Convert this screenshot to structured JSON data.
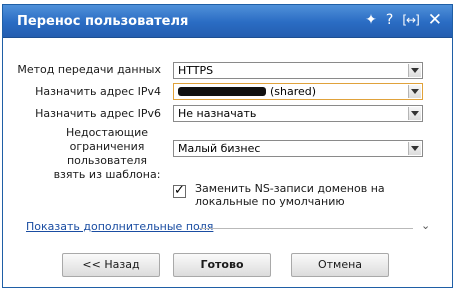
{
  "window": {
    "title": "Перенос пользователя",
    "icons": [
      "pin-icon",
      "help-icon",
      "maximize-icon",
      "close-icon"
    ]
  },
  "form": {
    "method_label": "Метод передачи данных",
    "method_value": "HTTPS",
    "ipv4_label": "Назначить адрес IPv4",
    "ipv4_value": "(shared)",
    "ipv6_label": "Назначить адрес IPv6",
    "ipv6_value": "Не назначать",
    "limits_label": "Недостающие ограничения пользователя взять из шаблона:",
    "limits_value": "Малый бизнес",
    "ns_checkbox_checked": true,
    "ns_checkbox_label": "Заменить NS-записи доменов на локальные по умолчанию"
  },
  "more_fields_link": "Показать дополнительные поля",
  "buttons": {
    "back": "<< Назад",
    "done": "Готово",
    "cancel": "Отмена"
  }
}
